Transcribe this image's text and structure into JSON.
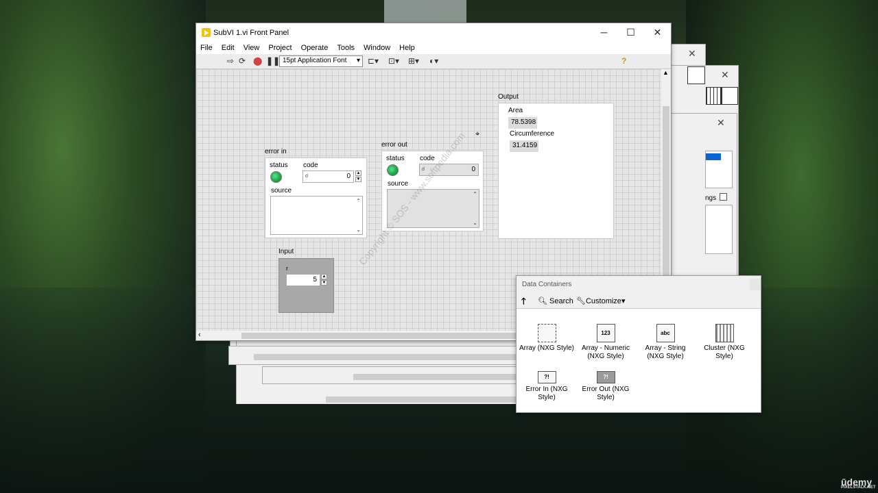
{
  "window": {
    "title": "SubVI 1.vi Front Panel",
    "minimize": "─",
    "maximize": "☐",
    "close": "✕"
  },
  "menu": [
    "File",
    "Edit",
    "View",
    "Project",
    "Operate",
    "Tools",
    "Window",
    "Help"
  ],
  "toolbar": {
    "font": "15pt Application Font",
    "help": "?"
  },
  "error_in": {
    "label": "error in",
    "status_label": "status",
    "code_label": "code",
    "code_value": "0",
    "numeric_marker": "d",
    "source_label": "source"
  },
  "error_out": {
    "label": "error out",
    "status_label": "status",
    "code_label": "code",
    "code_value": "0",
    "numeric_marker": "d",
    "source_label": "source"
  },
  "output": {
    "label": "Output",
    "area_label": "Area",
    "area_value": "78.5398",
    "circ_label": "Circumference",
    "circ_value": "31.4159"
  },
  "input": {
    "label": "Input",
    "r_label": "r",
    "r_value": "5"
  },
  "palette": {
    "title": "Data Containers",
    "search": "Search",
    "customize": "Customize",
    "items": [
      {
        "label": "Array (NXG Style)",
        "icon": ""
      },
      {
        "label": "Array - Numeric (NXG Style)",
        "icon": "123"
      },
      {
        "label": "Array - String (NXG Style)",
        "icon": "abc"
      },
      {
        "label": "Cluster (NXG Style)",
        "icon": ""
      },
      {
        "label": "Error In (NXG Style)",
        "icon": "?!"
      },
      {
        "label": "Error Out (NXG Style)",
        "icon": "?!"
      }
    ]
  },
  "background_window": {
    "fragment_label": "ngs"
  },
  "watermark": "Copyright © SOS - www.softpedia.com",
  "branding": {
    "udemy": "ūdemy",
    "site": "PIXELSTALK.NET"
  }
}
